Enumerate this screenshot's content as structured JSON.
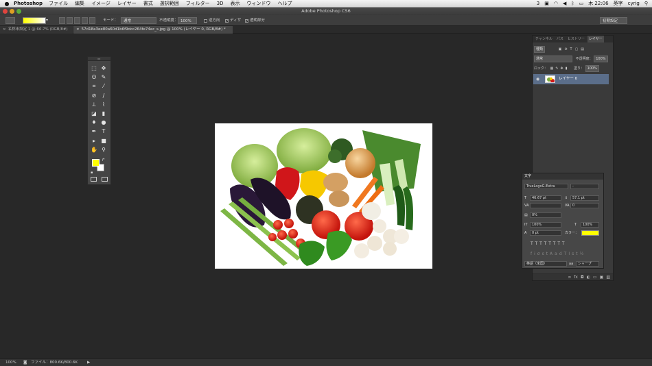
{
  "menubar": {
    "apple": "",
    "app": "Photoshop",
    "items": [
      "ファイル",
      "編集",
      "イメージ",
      "レイヤー",
      "書式",
      "選択範囲",
      "フィルター",
      "3D",
      "表示",
      "ウィンドウ",
      "ヘルプ"
    ],
    "status": {
      "badge": "3",
      "clock": "木 22:06",
      "input": "英字",
      "user": "cyrig"
    }
  },
  "window": {
    "title": "Adobe Photoshop CS6"
  },
  "options": {
    "mode_label": "モード：",
    "mode_value": "通常",
    "opacity_label": "不透明度：",
    "opacity_value": "100%",
    "reverse_label": "逆方向",
    "dither_label": "ディザ",
    "transparency_label": "透明部分",
    "workspace": "初期設定",
    "gradient_colors": [
      "#ffff00",
      "#ffffff"
    ]
  },
  "tabs": [
    {
      "label": "名称未設定 1 @ 66.7% (RGB/8#)",
      "close": "×"
    },
    {
      "label": "57d18a3ee80a60d1b6f9dcc264fe74ec_s.jpg @ 100% (レイヤー 0, RGB/8#) *",
      "close": "×"
    }
  ],
  "tools": {
    "foreground": "#ffff00",
    "background": "#ffffff",
    "icons": [
      "move-icon",
      "marquee-icon",
      "lasso-icon",
      "quick-select-icon",
      "crop-icon",
      "eyedropper-icon",
      "healing-icon",
      "brush-icon",
      "stamp-icon",
      "history-brush-icon",
      "eraser-icon",
      "gradient-icon",
      "blur-icon",
      "dodge-icon",
      "pen-icon",
      "type-icon",
      "path-select-icon",
      "shape-icon",
      "hand-icon",
      "zoom-icon"
    ]
  },
  "layers_panel": {
    "tabs": [
      "チャンネル",
      "パス",
      "ヒストリー",
      "レイヤー"
    ],
    "active_tab": "レイヤー",
    "filter_label": "種類",
    "blend_mode": "通常",
    "opacity_label": "不透明度：",
    "opacity_value": "100%",
    "lock_label": "ロック：",
    "fill_label": "塗り：",
    "fill_value": "100%",
    "layer_name": "レイヤー 0"
  },
  "character_panel": {
    "title": "文字",
    "font_family": "TrueLogoG-Extra",
    "font_style": "-",
    "font_size": "46.67 pt",
    "leading": "57.1 pt",
    "tracking": "0",
    "kerning_percent": "0%",
    "vertical_scale": "100%",
    "horizontal_scale": "100%",
    "baseline_shift": "0 pt",
    "color_label": "カラー：",
    "color": "#ffff00",
    "language": "英語（米国）",
    "antialias_label": "aa",
    "antialias": "シャープ"
  },
  "status": {
    "zoom": "100%",
    "info": "ファイル：800.6K/800.6K"
  }
}
